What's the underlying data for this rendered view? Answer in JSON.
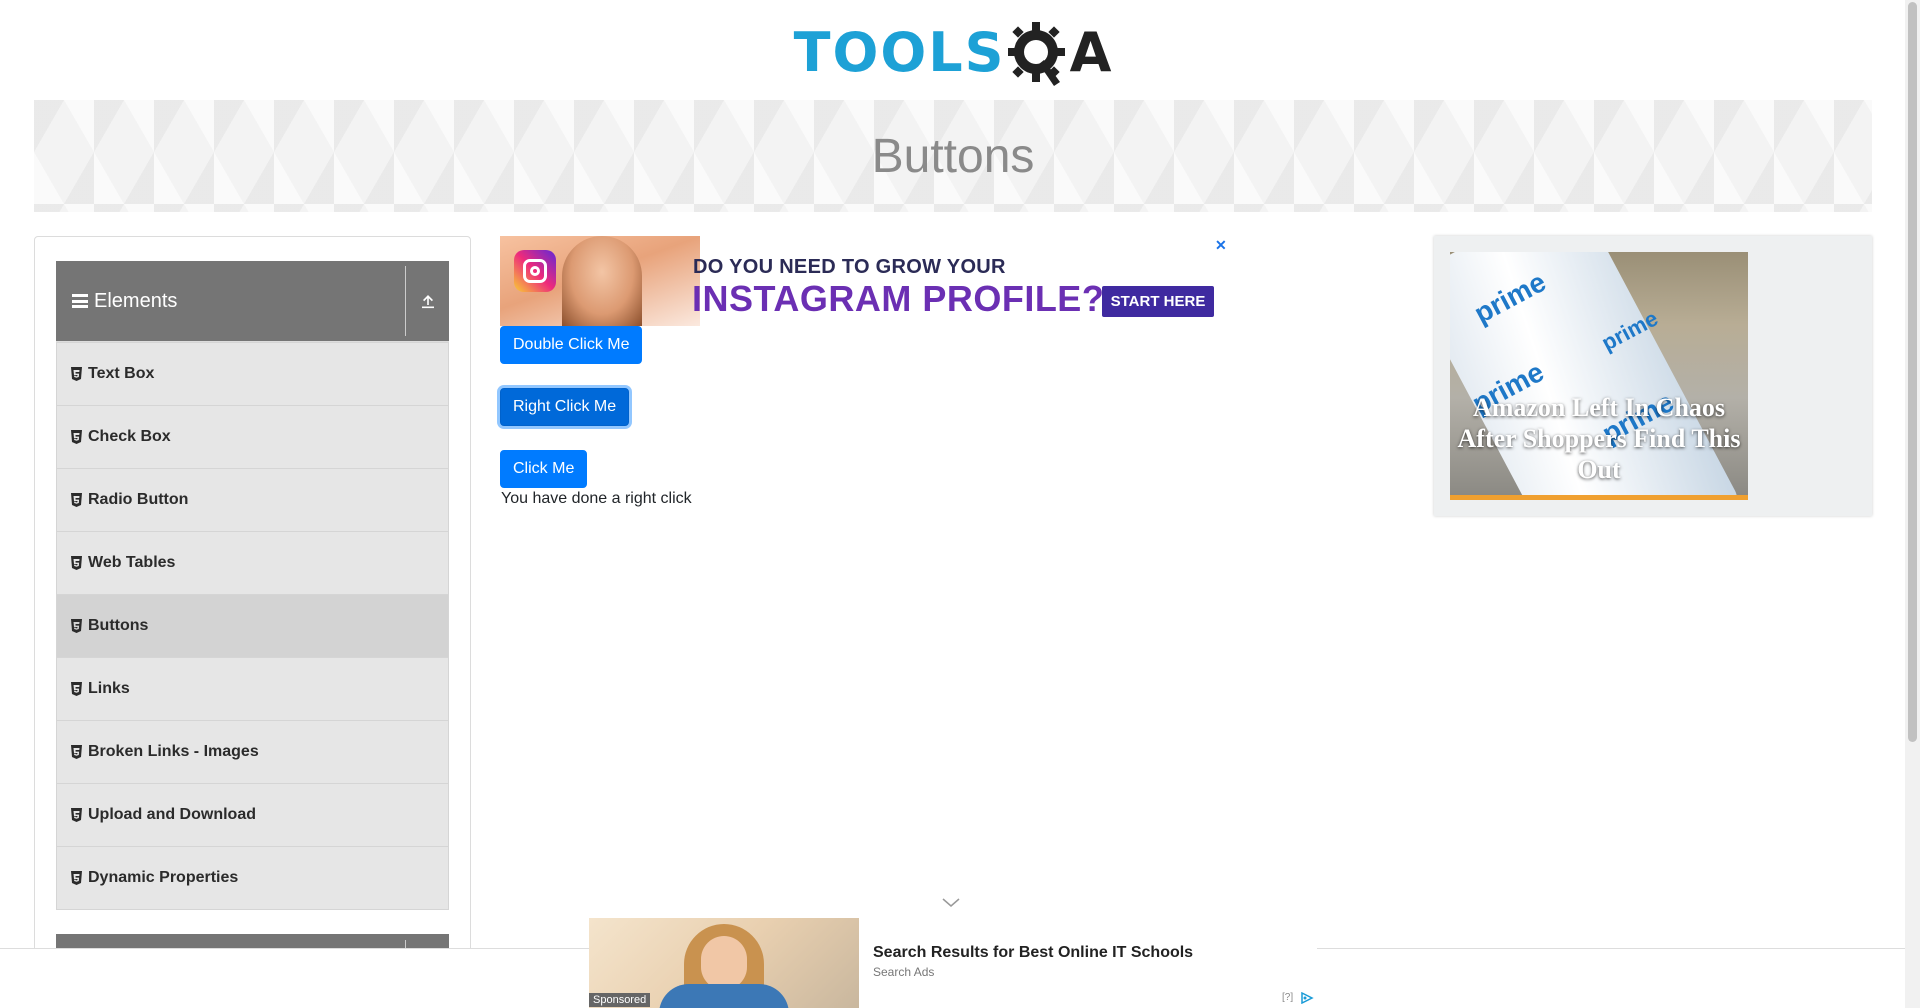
{
  "header": {
    "logo_part1": "TOOLS",
    "logo_part2": "A"
  },
  "banner": {
    "title": "Buttons"
  },
  "sidebar": {
    "group_label": "Elements",
    "items": [
      {
        "label": "Text Box"
      },
      {
        "label": "Check Box"
      },
      {
        "label": "Radio Button"
      },
      {
        "label": "Web Tables"
      },
      {
        "label": "Buttons",
        "active": true
      },
      {
        "label": "Links"
      },
      {
        "label": "Broken Links - Images"
      },
      {
        "label": "Upload and Download"
      },
      {
        "label": "Dynamic Properties"
      }
    ]
  },
  "ad_top": {
    "line1": "DO YOU NEED TO GROW YOUR",
    "line2": "INSTAGRAM PROFILE?",
    "cta": "START HERE",
    "close": "✕"
  },
  "main": {
    "double_click_label": "Double Click Me",
    "right_click_label": "Right Click Me",
    "click_label": "Click Me",
    "result_message": "You have done a right click"
  },
  "ad_right": {
    "prime_text": "prime",
    "headline": "Amazon Left In Chaos After Shoppers Find This Out"
  },
  "ad_bottom": {
    "title": "Search Results for Best Online IT Schools",
    "source": "Search Ads",
    "sponsored": "Sponsored",
    "adchoice": "[?]"
  },
  "colors": {
    "primary_button": "#007bff",
    "sidebar_header": "#757575",
    "logo_blue": "#1da1d6"
  }
}
